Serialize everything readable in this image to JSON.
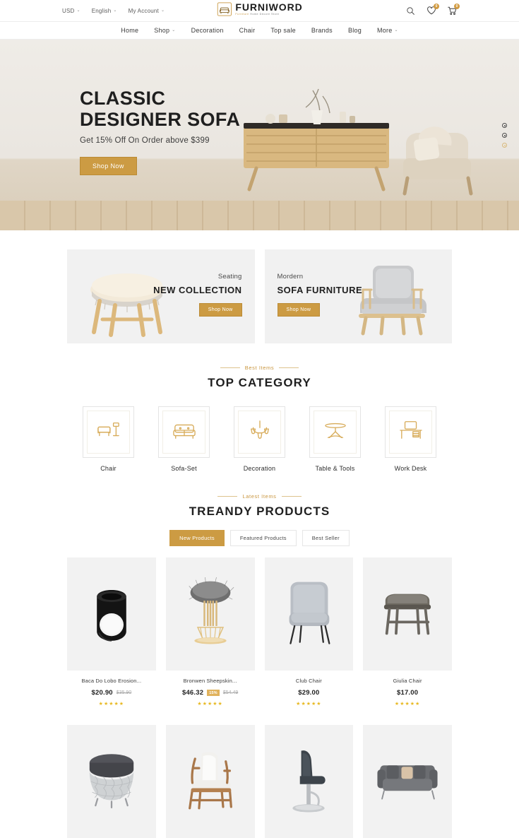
{
  "topbar": {
    "currency": "USD",
    "language": "English",
    "account": "My Account",
    "caret": "⌄",
    "search_icon": "search-icon",
    "wishlist_icon": "heart-icon",
    "wishlist_count": "0",
    "cart_icon": "cart-icon",
    "cart_count": "0"
  },
  "logo": {
    "name": "FURNIWORD",
    "tagline_highlight": "Furniture",
    "tagline_rest": "Home Decore Store"
  },
  "nav": {
    "items": [
      {
        "label": "Home",
        "caret": ""
      },
      {
        "label": "Shop",
        "caret": "⌄"
      },
      {
        "label": "Decoration",
        "caret": ""
      },
      {
        "label": "Chair",
        "caret": ""
      },
      {
        "label": "Top sale",
        "caret": ""
      },
      {
        "label": "Brands",
        "caret": ""
      },
      {
        "label": "Blog",
        "caret": ""
      },
      {
        "label": "More",
        "caret": "⌄"
      }
    ]
  },
  "hero": {
    "title_line1": "CLASSIC",
    "title_line2": "DESIGNER SOFA",
    "subtitle": "Get 15% Off On Order above $399",
    "cta": "Shop Now",
    "slides": 3,
    "active_slide": 3
  },
  "promos": [
    {
      "kicker": "Seating",
      "title": "NEW COLLECTION",
      "cta": "Shop Now",
      "art": "stool-art"
    },
    {
      "kicker": "Mordern",
      "title": "SOFA FURNITURE",
      "cta": "Shop Now",
      "art": "armchair-art"
    }
  ],
  "category_section": {
    "kicker": "Best Items",
    "title": "TOP CATEGORY",
    "items": [
      {
        "label": "Chair",
        "icon": "chair-lamp-icon"
      },
      {
        "label": "Sofa-Set",
        "icon": "sofa-icon"
      },
      {
        "label": "Decoration",
        "icon": "chandelier-icon"
      },
      {
        "label": "Table & Tools",
        "icon": "table-icon"
      },
      {
        "label": "Work Desk",
        "icon": "desk-icon"
      }
    ]
  },
  "products_section": {
    "kicker": "Latest Items",
    "title": "TREANDY PRODUCTS",
    "tabs": [
      {
        "label": "New Products",
        "active": true
      },
      {
        "label": "Featured Products",
        "active": false
      },
      {
        "label": "Best Seller",
        "active": false
      }
    ],
    "row1": [
      {
        "name": "Baca Do Lobo Erosion...",
        "price": "$20.90",
        "old_price": "$35.90",
        "discount": "",
        "stars": "★★★★★",
        "art": "black-vessel-art"
      },
      {
        "name": "Bronwen Sheepskin...",
        "price": "$46.32",
        "old_price": "$54.49",
        "discount": "15%",
        "stars": "★★★★★",
        "art": "fur-stool-art"
      },
      {
        "name": "Club Chair",
        "price": "$29.00",
        "old_price": "",
        "discount": "",
        "stars": "★★★★★",
        "art": "grey-club-chair-art"
      },
      {
        "name": "Giulia Chair",
        "price": "$17.00",
        "old_price": "",
        "discount": "",
        "stars": "★★★★★",
        "art": "wood-bench-art"
      }
    ],
    "row2": [
      {
        "art": "quilted-ottoman-art"
      },
      {
        "art": "white-wood-armchair-art"
      },
      {
        "art": "bar-stool-art"
      },
      {
        "art": "grey-sofa-art"
      }
    ]
  },
  "colors": {
    "accent": "#cc9b43",
    "accent_light": "#e0b25c",
    "star": "#e8b923",
    "text": "#1f1f1f",
    "panel": "#f1f1f1"
  }
}
